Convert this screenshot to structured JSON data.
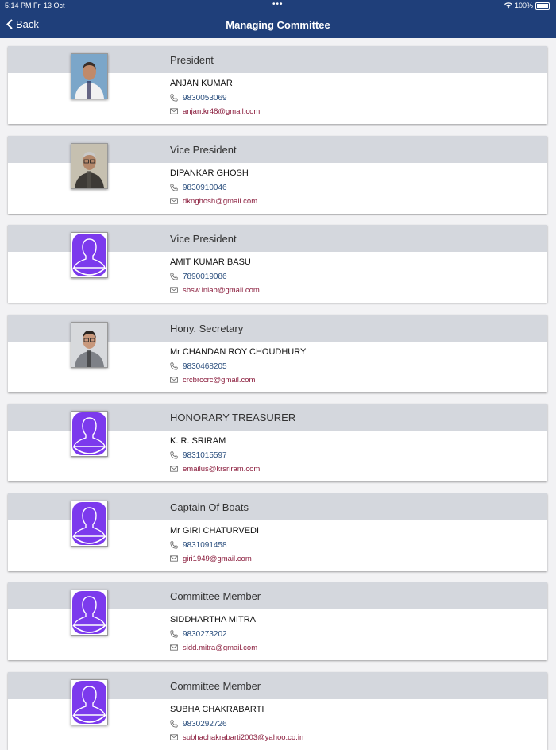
{
  "status_bar": {
    "time": "5:14 PM  Fri 13 Oct",
    "battery": "100%"
  },
  "nav": {
    "back_label": "Back",
    "title": "Managing Committee"
  },
  "members": [
    {
      "role": "President",
      "name": "ANJAN  KUMAR",
      "phone": "9830053069",
      "email": "anjan.kr48@gmail.com",
      "photo": "photo-man-white-shirt"
    },
    {
      "role": "Vice President",
      "name": "DIPANKAR GHOSH",
      "phone": " 9830910046",
      "email": "dknghosh@gmail.com",
      "photo": "photo-man-grey-hair"
    },
    {
      "role": "Vice President",
      "name": "AMIT KUMAR BASU",
      "phone": "7890019086",
      "email": "sbsw.inlab@gmail.com",
      "photo": "placeholder-avatar"
    },
    {
      "role": "Hony. Secretary",
      "name": "Mr CHANDAN ROY CHOUDHURY",
      "phone": "9830468205",
      "email": "crcbrccrc@gmail.com",
      "photo": "photo-man-glasses"
    },
    {
      "role": "HONORARY TREASURER",
      "name": "K. R. SRIRAM",
      "phone": "9831015597",
      "email": "emailus@krsriram.com",
      "photo": "placeholder-avatar"
    },
    {
      "role": "Captain  Of Boats",
      "name": "Mr GIRI CHATURVEDI",
      "phone": "9831091458",
      "email": "giri1949@gmail.com",
      "photo": "placeholder-avatar"
    },
    {
      "role": "Committee Member",
      "name": "SIDDHARTHA MITRA",
      "phone": "9830273202",
      "email": "sidd.mitra@gmail.com",
      "photo": "placeholder-avatar"
    },
    {
      "role": "Committee Member",
      "name": "SUBHA  CHAKRABARTI",
      "phone": "9830292726",
      "email": "subhachakrabarti2003@yahoo.co.in",
      "photo": "placeholder-avatar"
    }
  ],
  "colors": {
    "nav": "#1f3f7a",
    "phone_text": "#2b4f7e",
    "email_text": "#8a1c3c",
    "avatar": "#7c3aed"
  }
}
